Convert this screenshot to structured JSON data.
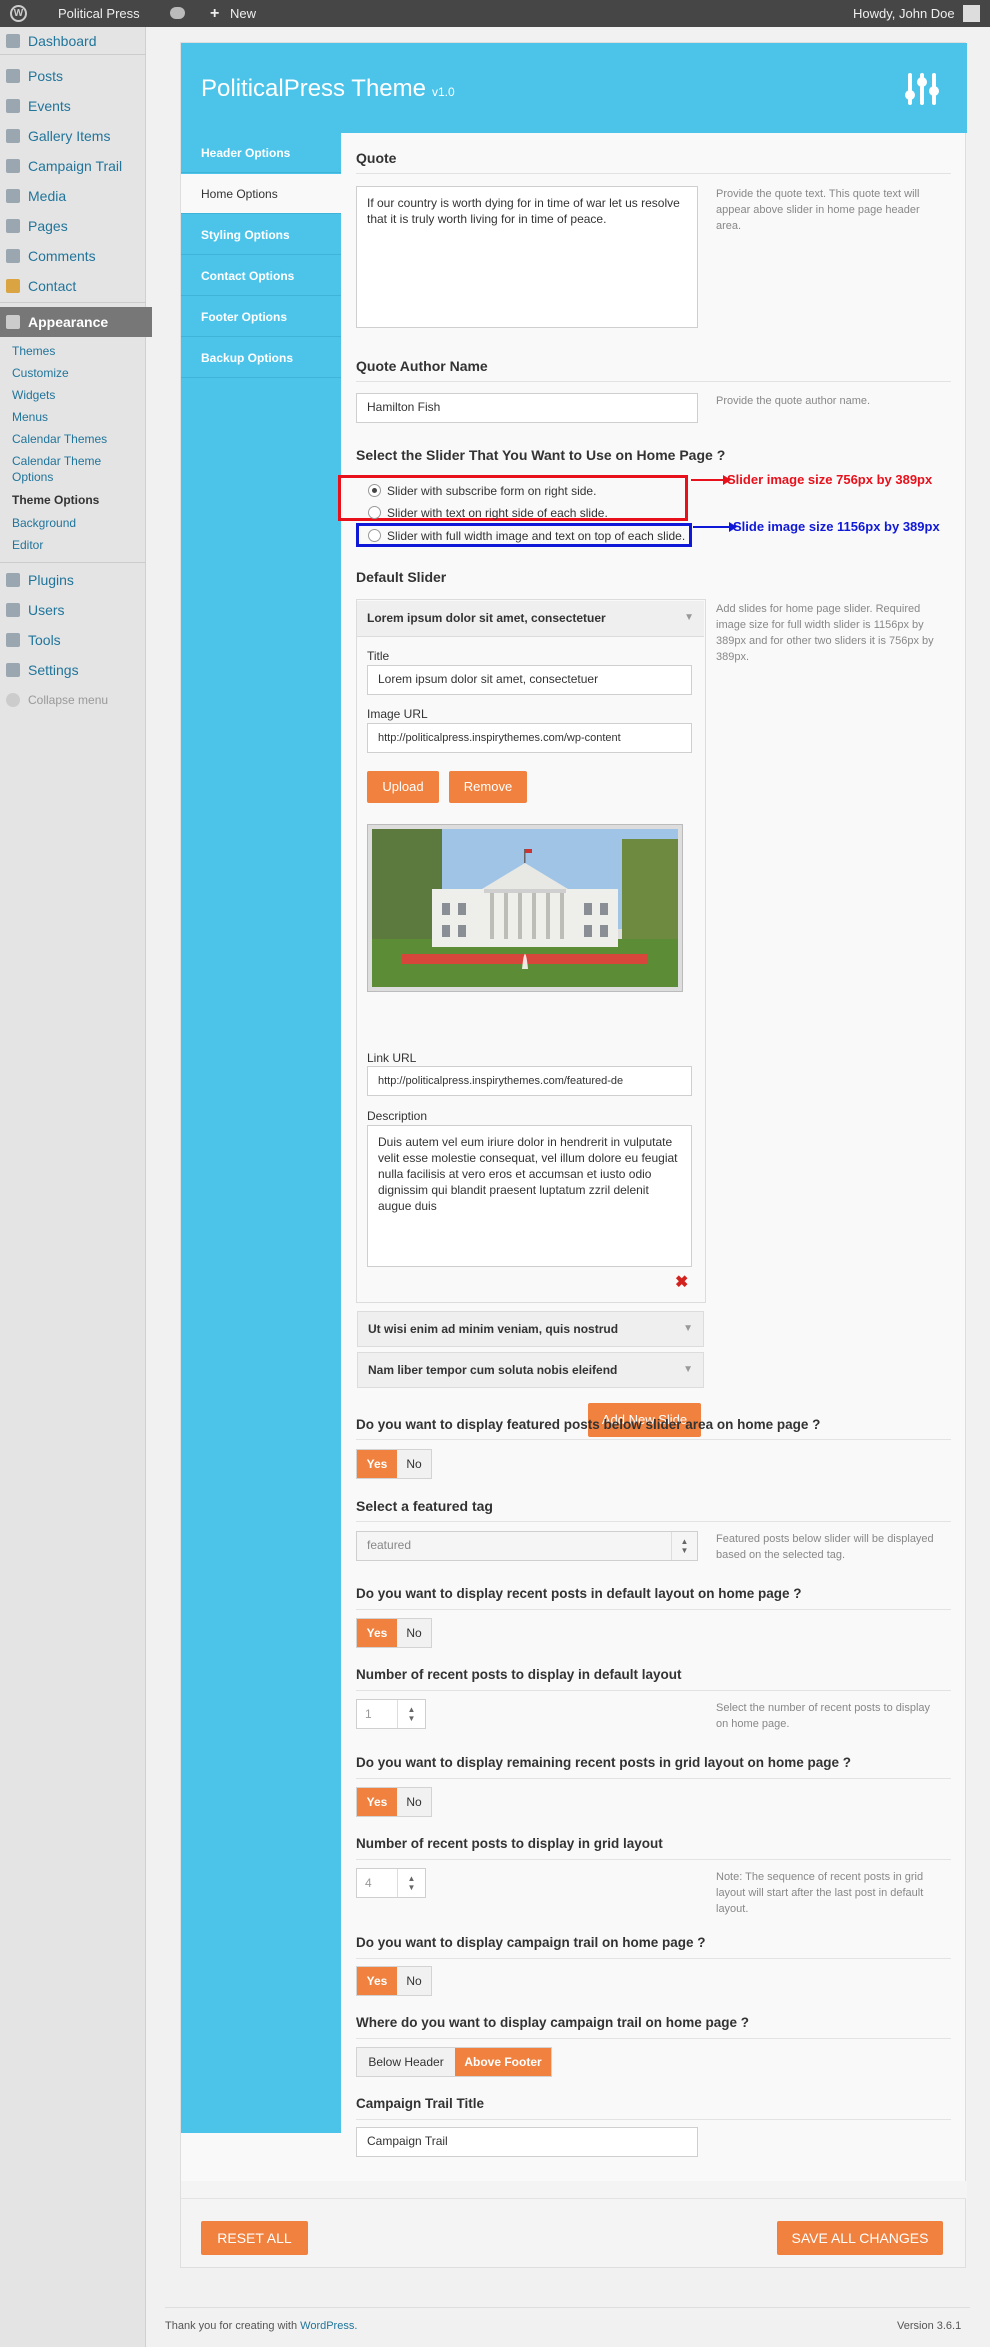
{
  "admin_bar": {
    "site_name": "Political Press",
    "new_label": "New",
    "howdy": "Howdy, John Doe"
  },
  "menu": {
    "items": [
      {
        "label": "Dashboard"
      },
      {
        "label": "Posts"
      },
      {
        "label": "Events"
      },
      {
        "label": "Gallery Items"
      },
      {
        "label": "Campaign Trail"
      },
      {
        "label": "Media"
      },
      {
        "label": "Pages"
      },
      {
        "label": "Comments"
      },
      {
        "label": "Contact"
      },
      {
        "label": "Appearance"
      },
      {
        "label": "Plugins"
      },
      {
        "label": "Users"
      },
      {
        "label": "Tools"
      },
      {
        "label": "Settings"
      }
    ],
    "submenu": [
      "Themes",
      "Customize",
      "Widgets",
      "Menus",
      "Calendar Themes",
      "Calendar Theme",
      "Options",
      "Theme Options",
      "Background",
      "Editor"
    ],
    "collapse": "Collapse menu"
  },
  "panel": {
    "title": "PoliticalPress Theme",
    "version": "v1.0",
    "tabs": [
      "Header Options",
      "Home Options",
      "Styling Options",
      "Contact Options",
      "Footer Options",
      "Backup Options"
    ]
  },
  "quote": {
    "heading": "Quote",
    "value": "If our country is worth dying for in time of war let us resolve that it is truly worth living for in time of peace.",
    "help": "Provide the quote text. This quote text will appear above slider in home page header area."
  },
  "quote_author": {
    "heading": "Quote Author Name",
    "value": "Hamilton Fish",
    "help": "Provide the quote author name."
  },
  "slider_select": {
    "heading": "Select the Slider That You Want to Use on Home Page ?",
    "options": [
      "Slider with subscribe form on right side.",
      "Slider with text on right side of each slide.",
      "Slider with full width image and text on top of each slide."
    ],
    "note_red": "Slider image size 756px by 389px",
    "note_blue": "Slide image size 1156px by 389px",
    "red_color": "#e8101b",
    "blue_color": "#1018d8"
  },
  "default_slider": {
    "heading": "Default Slider",
    "help": "Add slides for home page slider. Required image size for full width slider is 1156px by 389px and for other two sliders it is 756px by 389px.",
    "slide1_header": "Lorem ipsum dolor sit amet, consectetuer",
    "title_label": "Title",
    "title_value": "Lorem ipsum dolor sit amet, consectetuer",
    "image_url_label": "Image URL",
    "image_url_value": "http://politicalpress.inspirythemes.com/wp-content",
    "upload": "Upload",
    "remove": "Remove",
    "link_url_label": "Link URL",
    "link_url_value": "http://politicalpress.inspirythemes.com/featured-de",
    "desc_label": "Description",
    "desc_value": "Duis autem vel eum iriure dolor in hendrerit in vulputate velit esse molestie consequat, vel illum dolore eu feugiat nulla facilisis at vero eros et accumsan et iusto odio dignissim qui blandit praesent luptatum zzril delenit augue duis",
    "slide2_header": "Ut wisi enim ad minim veniam, quis nostrud",
    "slide3_header": "Nam liber tempor cum soluta nobis eleifend",
    "add_new": "Add New Slide"
  },
  "featured_posts": {
    "heading": "Do you want to display featured posts below slider area on home page ?",
    "yes": "Yes",
    "no": "No"
  },
  "featured_tag": {
    "heading": "Select a featured tag",
    "value": "featured",
    "help": "Featured posts below slider will be displayed based on the selected tag."
  },
  "recent_default": {
    "heading": "Do you want to display recent posts in default layout on home page ?",
    "yes": "Yes",
    "no": "No"
  },
  "recent_default_num": {
    "heading": "Number of recent posts to display in default layout",
    "value": "1",
    "help": "Select the number of recent posts to display on home page."
  },
  "recent_grid": {
    "heading": "Do you want to display remaining recent posts in grid layout on home page ?",
    "yes": "Yes",
    "no": "No"
  },
  "recent_grid_num": {
    "heading": "Number of recent posts to display in grid layout",
    "value": "4",
    "help": "Note: The sequence of recent posts in grid layout will start after the last post in default layout."
  },
  "campaign_trail": {
    "heading": "Do you want to display campaign trail on home page ?",
    "yes": "Yes",
    "no": "No"
  },
  "campaign_where": {
    "heading": "Where do you want to display campaign trail on home page ?",
    "below": "Below Header",
    "above": "Above Footer"
  },
  "campaign_title": {
    "heading": "Campaign Trail Title",
    "value": "Campaign Trail"
  },
  "actions": {
    "reset": "RESET ALL",
    "save": "SAVE ALL CHANGES"
  },
  "footer": {
    "thanks": "Thank you for creating with",
    "wp": "WordPress.",
    "version": "Version 3.6.1"
  }
}
